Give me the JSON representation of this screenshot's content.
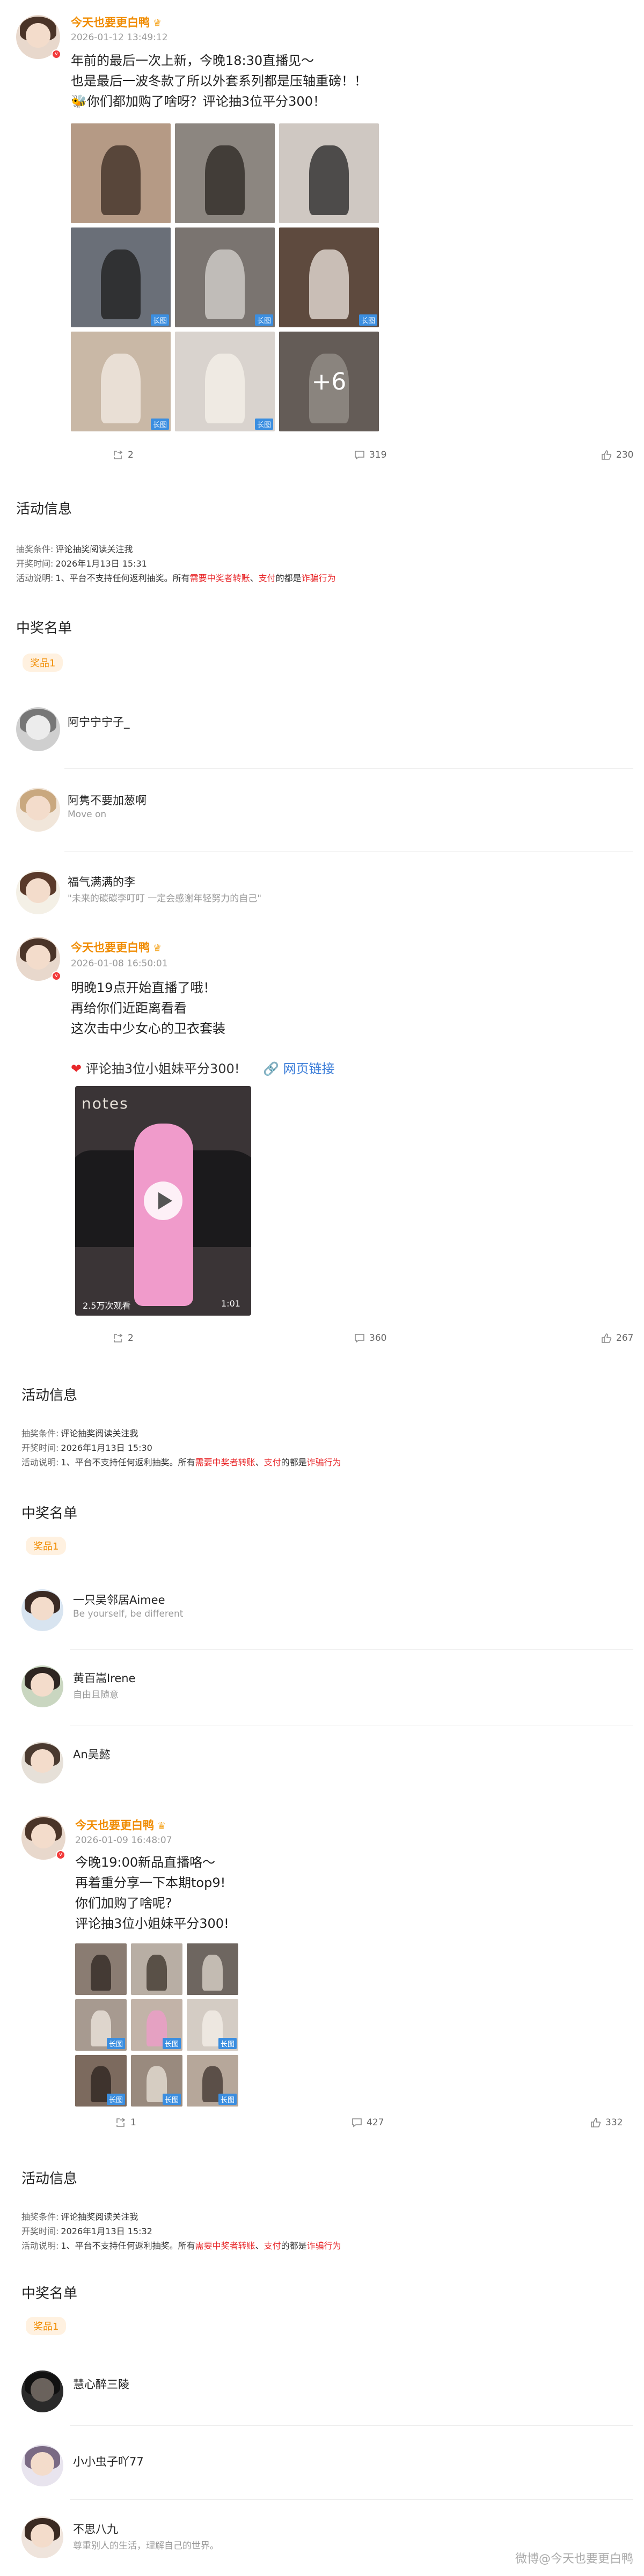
{
  "posts": [
    {
      "author": "今天也要更白鸭",
      "time": "2026-01-12 13:49:12",
      "text": "年前的最后一次上新，今晚18:30直播见～\n也是最后一波冬款了所以外套系列都是压轴重磅！！\n🐝你们都加购了啥呀？评论抽3位平分300！",
      "grid_more": "+6",
      "long_tag": "长图",
      "repost": "2",
      "comments": "319",
      "likes": "230"
    },
    {
      "author": "今天也要更白鸭",
      "time": "2026-01-08 16:50:01",
      "text": "明晚19点开始直播了哦！\n再给你们近距离看看\n这次击中少女心的卫衣套装",
      "lottery_line": "评论抽3位小姐妹平分300!",
      "link_text": "网页链接",
      "video_views": "2.5万次观看",
      "video_duration": "1:01",
      "video_sign": "notes",
      "repost": "2",
      "comments": "360",
      "likes": "267"
    },
    {
      "author": "今天也要更白鸭",
      "time": "2026-01-09 16:48:07",
      "text": "今晚19:00新品直播咯～\n再着重分享一下本期top9!\n你们加购了啥呢?\n评论抽3位小姐妹平分300!",
      "long_tag": "长图",
      "repost": "1",
      "comments": "427",
      "likes": "332"
    }
  ],
  "activities": [
    {
      "title": "活动信息",
      "cond_label": "抽奖条件:",
      "cond_value": "评论抽奖阅读关注我",
      "open_label": "开奖时间:",
      "open_value": "2026年1月13日 15:31",
      "note_label": "活动说明:",
      "note_a": "1、平台不支持任何返利抽奖。所有",
      "note_b": "需要中奖者转账",
      "note_c": "、",
      "note_d": "支付",
      "note_e": "的都是",
      "note_f": "诈骗行为",
      "winners_title": "中奖名单",
      "prize": "奖品1",
      "winners": [
        {
          "name": "阿宁宁宁子_",
          "sub": ""
        },
        {
          "name": "阿隽不要加葱啊",
          "sub": "Move on"
        },
        {
          "name": "福气满满的李",
          "sub": "\"未来的碳碳李叮叮 一定会感谢年轻努力的自己\""
        }
      ]
    },
    {
      "title": "活动信息",
      "cond_label": "抽奖条件:",
      "cond_value": "评论抽奖阅读关注我",
      "open_label": "开奖时间:",
      "open_value": "2026年1月13日 15:30",
      "note_label": "活动说明:",
      "note_a": "1、平台不支持任何返利抽奖。所有",
      "note_b": "需要中奖者转账",
      "note_c": "、",
      "note_d": "支付",
      "note_e": "的都是",
      "note_f": "诈骗行为",
      "winners_title": "中奖名单",
      "prize": "奖品1",
      "winners": [
        {
          "name": "一只吴邻居Aimee",
          "sub": "Be yourself, be different"
        },
        {
          "name": "黄百嵩Irene",
          "sub": "自由且随意"
        },
        {
          "name": "An吴懿",
          "sub": ""
        }
      ]
    },
    {
      "title": "活动信息",
      "cond_label": "抽奖条件:",
      "cond_value": "评论抽奖阅读关注我",
      "open_label": "开奖时间:",
      "open_value": "2026年1月13日 15:32",
      "note_label": "活动说明:",
      "note_a": "1、平台不支持任何返利抽奖。所有",
      "note_b": "需要中奖者转账",
      "note_c": "、",
      "note_d": "支付",
      "note_e": "的都是",
      "note_f": "诈骗行为",
      "winners_title": "中奖名单",
      "prize": "奖品1",
      "winners": [
        {
          "name": "慧心醉三陵",
          "sub": ""
        },
        {
          "name": "小小虫子吖77",
          "sub": ""
        },
        {
          "name": "不思八九",
          "sub": "尊重别人的生活，理解自己的世界。"
        }
      ]
    }
  ],
  "watermark": "微博@今天也要更白鸭",
  "colors": {
    "author": "#f08c00",
    "warning": "#e8282b",
    "link": "#3b7dd8",
    "long_tag": "#3b8ee0"
  }
}
